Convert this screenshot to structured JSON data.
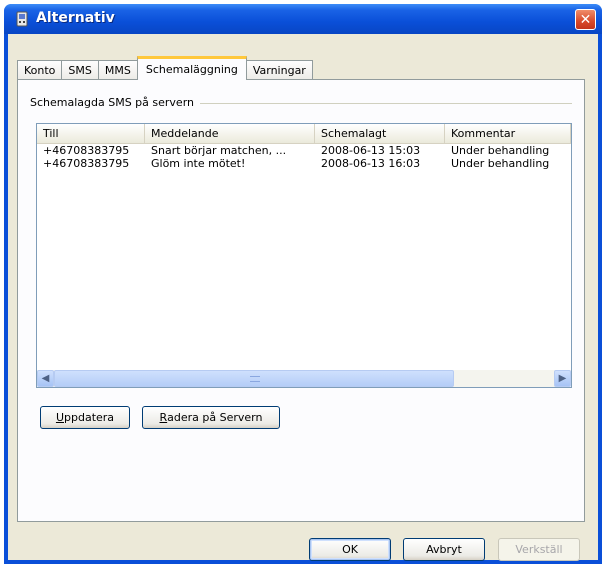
{
  "window": {
    "title": "Alternativ",
    "close_glyph": "✕"
  },
  "tabs": [
    {
      "label": "Konto"
    },
    {
      "label": "SMS"
    },
    {
      "label": "MMS"
    },
    {
      "label": "Schemaläggning",
      "active": true
    },
    {
      "label": "Varningar"
    }
  ],
  "group": {
    "label": "Schemalagda SMS på servern"
  },
  "table": {
    "columns": [
      "Till",
      "Meddelande",
      "Schemalagt",
      "Kommentar"
    ],
    "rows": [
      [
        "+46708383795",
        "Snart börjar matchen, ...",
        "2008-06-13 15:03",
        "Under behandling"
      ],
      [
        "+46708383795",
        "Glöm inte mötet!",
        "2008-06-13 16:03",
        "Under behandling"
      ]
    ]
  },
  "buttons": {
    "update_first": "U",
    "update_rest": "ppdatera",
    "delete_first": "R",
    "delete_rest": "adera på Servern",
    "ok": "OK",
    "cancel": "Avbryt",
    "apply": "Verkställ"
  },
  "icons": {
    "app": "app-icon",
    "close": "close-icon",
    "scroll_left": "◀",
    "scroll_right": "▶"
  }
}
